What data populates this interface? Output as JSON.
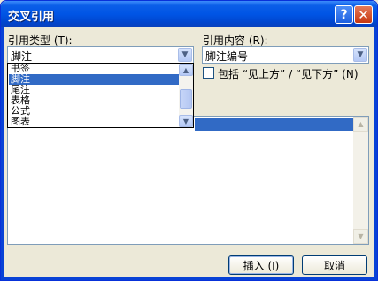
{
  "window": {
    "title": "交叉引用"
  },
  "titlebar": {
    "help_glyph": "?",
    "close_glyph": "✕"
  },
  "reference_type": {
    "label": "引用类型 (T):",
    "value": "脚注",
    "options": [
      "书签",
      "脚注",
      "尾注",
      "表格",
      "公式",
      "图表"
    ],
    "selected_index": 1
  },
  "reference_content": {
    "label": "引用内容 (R):",
    "value": "脚注编号"
  },
  "include_above_below": {
    "label": "包括 “见上方” / “见下方” (N)",
    "checked": false
  },
  "buttons": {
    "insert": "插入 (I)",
    "cancel": "取消"
  }
}
